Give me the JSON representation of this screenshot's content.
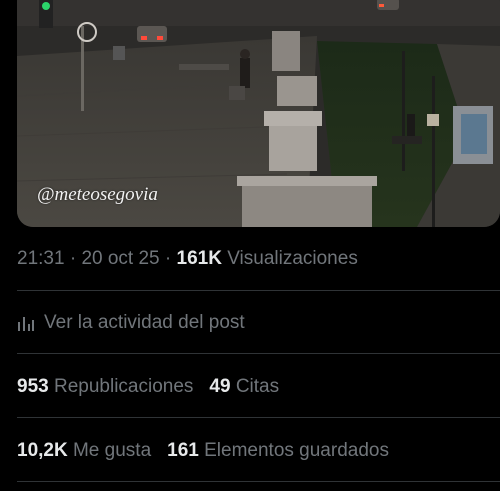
{
  "media": {
    "watermark": "@meteosegovia",
    "scene_icon": "street-photo"
  },
  "meta": {
    "time": "21:31",
    "date": "20 oct 25",
    "separator": "·",
    "views_count": "161K",
    "views_label": "Visualizaciones"
  },
  "activity": {
    "icon": "bar-chart-icon",
    "label": "Ver la actividad del post"
  },
  "stats": {
    "reposts_count": "953",
    "reposts_label": "Republicaciones",
    "quotes_count": "49",
    "quotes_label": "Citas",
    "likes_count": "10,2K",
    "likes_label": "Me gusta",
    "bookmarks_count": "161",
    "bookmarks_label": "Elementos guardados"
  },
  "colors": {
    "background": "#000000",
    "primary_text": "#e7e9ea",
    "secondary_text": "#71767b",
    "divider": "#2f3336"
  }
}
